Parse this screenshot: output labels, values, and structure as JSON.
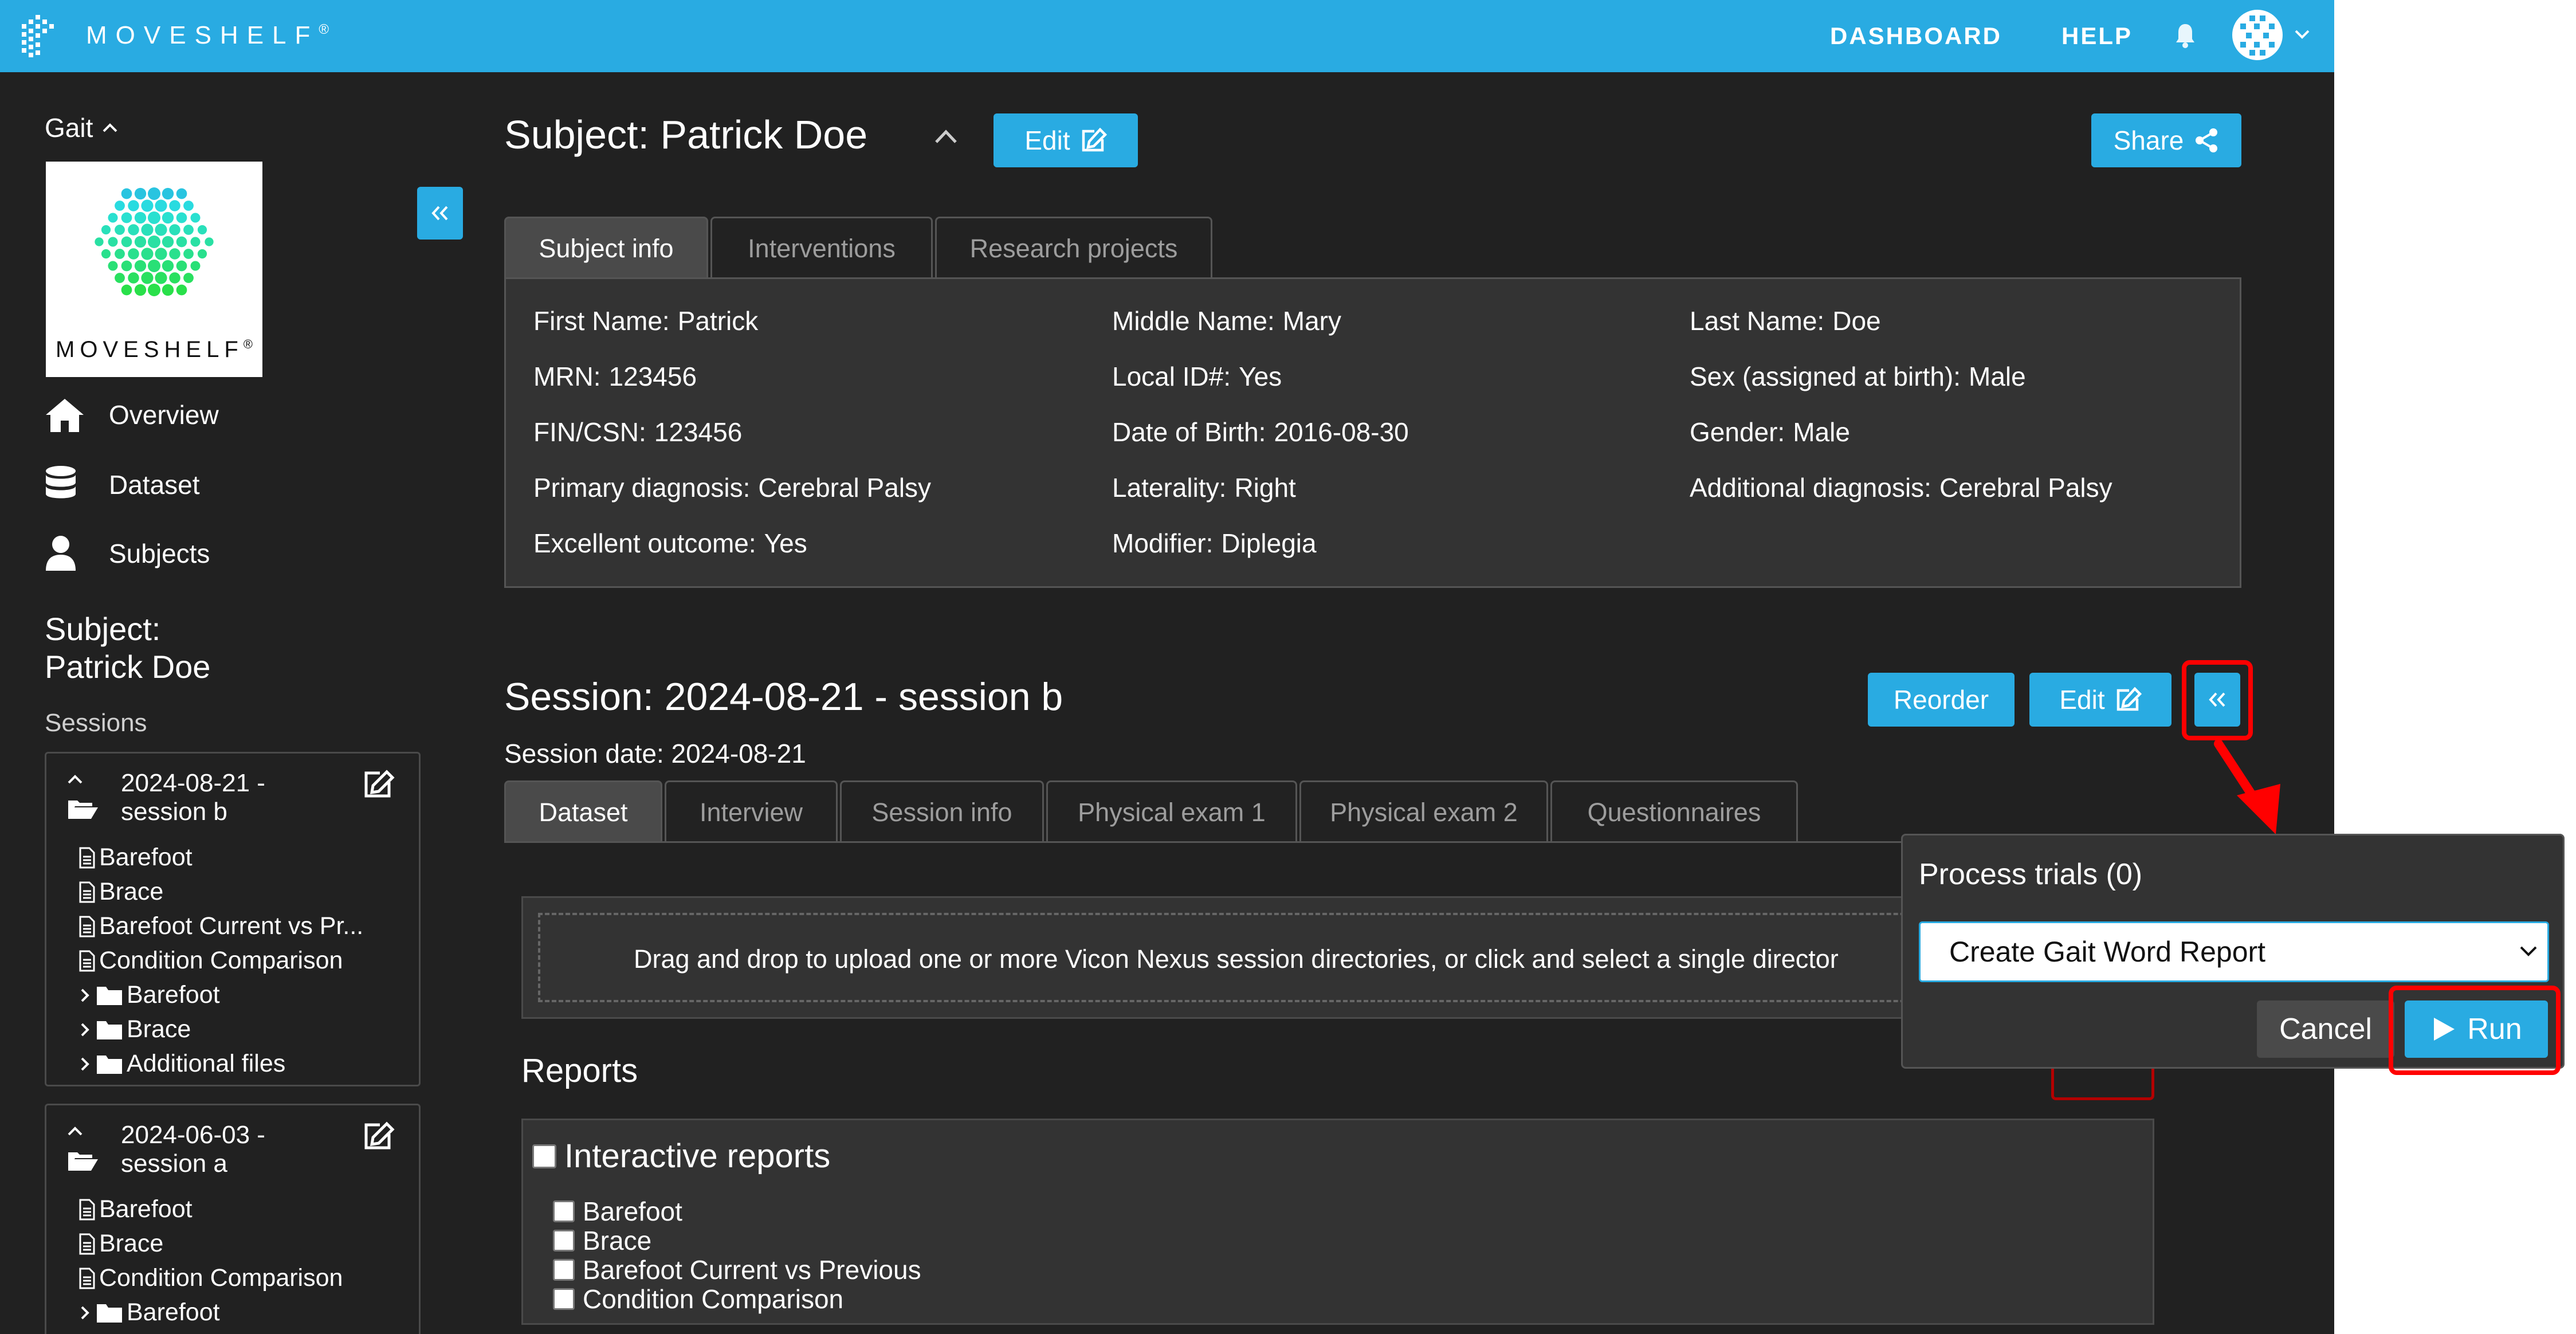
{
  "header": {
    "brand": "MOVESHELF",
    "brand_mark": "®",
    "nav": {
      "dashboard": "DASHBOARD",
      "help": "HELP"
    }
  },
  "sidebar": {
    "project": "Gait",
    "logo_text": "MOVESHELF",
    "nav": [
      {
        "label": "Overview",
        "icon": "home-icon"
      },
      {
        "label": "Dataset",
        "icon": "database-icon"
      },
      {
        "label": "Subjects",
        "icon": "user-icon"
      }
    ],
    "subject_heading_line1": "Subject:",
    "subject_heading_line2": "Patrick Doe",
    "sessions_label": "Sessions",
    "sessions": [
      {
        "title_line1": "2024-08-21 -",
        "title_line2": "session b",
        "files": [
          "Barefoot",
          "Brace",
          "Barefoot Current vs Pr...",
          "Condition Comparison"
        ],
        "folders": [
          "Barefoot",
          "Brace",
          "Additional files"
        ]
      },
      {
        "title_line1": "2024-06-03 -",
        "title_line2": "session a",
        "files": [
          "Barefoot",
          "Brace",
          "Condition Comparison"
        ],
        "folders": [
          "Barefoot"
        ]
      }
    ]
  },
  "subject": {
    "title": "Subject: Patrick Doe",
    "edit_label": "Edit",
    "share_label": "Share",
    "tabs": [
      "Subject info",
      "Interventions",
      "Research projects"
    ],
    "fields": [
      {
        "label": "First Name:",
        "value": "Patrick"
      },
      {
        "label": "Middle Name:",
        "value": "Mary"
      },
      {
        "label": "Last Name:",
        "value": "Doe"
      },
      {
        "label": "MRN:",
        "value": "123456"
      },
      {
        "label": "Local ID#:",
        "value": "Yes"
      },
      {
        "label": "Sex (assigned at birth):",
        "value": "Male"
      },
      {
        "label": "FIN/CSN:",
        "value": "123456"
      },
      {
        "label": "Date of Birth:",
        "value": "2016-08-30"
      },
      {
        "label": "Gender:",
        "value": "Male"
      },
      {
        "label": "Primary diagnosis:",
        "value": "Cerebral Palsy"
      },
      {
        "label": "Laterality:",
        "value": "Right"
      },
      {
        "label": "Additional diagnosis:",
        "value": "Cerebral Palsy"
      },
      {
        "label": "Excellent outcome:",
        "value": "Yes"
      },
      {
        "label": "Modifier:",
        "value": "Diplegia"
      }
    ]
  },
  "session": {
    "title": "Session: 2024-08-21 - session b",
    "date_line": "Session date: 2024-08-21",
    "reorder_label": "Reorder",
    "edit_label": "Edit",
    "tabs": [
      "Dataset",
      "Interview",
      "Session info",
      "Physical exam 1",
      "Physical exam 2",
      "Questionnaires"
    ],
    "dropzone_text": "Drag and drop to upload one or more Vicon Nexus session directories, or click and select a single director",
    "reports_heading": "Reports",
    "interactive_reports_label": "Interactive reports",
    "reports": [
      "Barefoot",
      "Brace",
      "Barefoot Current vs Previous",
      "Condition Comparison"
    ]
  },
  "popover": {
    "title": "Process trials (0)",
    "selected_option": "Create Gait Word Report",
    "cancel_label": "Cancel",
    "run_label": "Run"
  },
  "colors": {
    "accent": "#29abe2",
    "background": "#212121",
    "panel": "#333333",
    "highlight": "#ff0000"
  }
}
